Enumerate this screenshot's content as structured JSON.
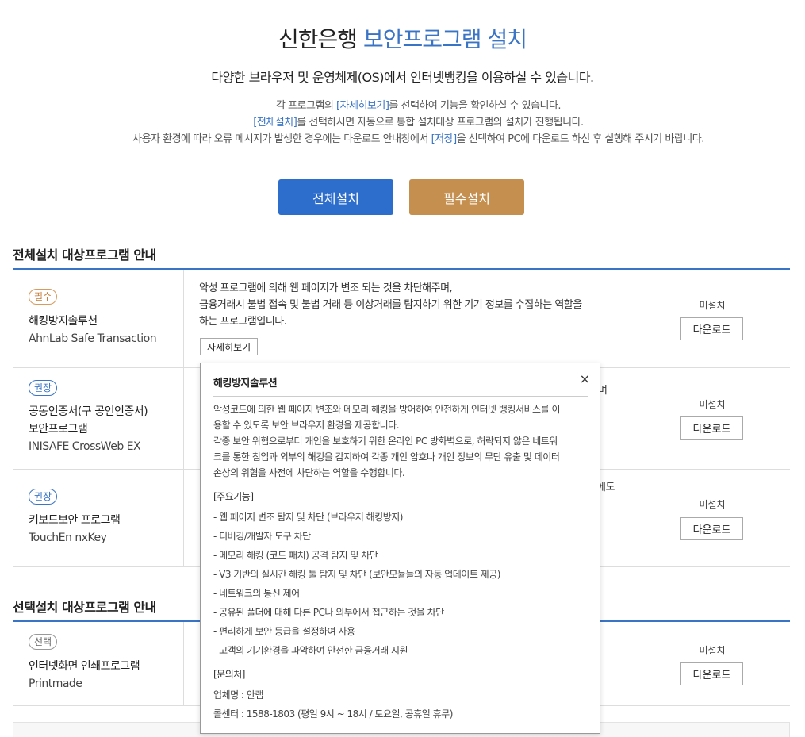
{
  "header": {
    "title_prefix": "신한은행",
    "title_accent": "보안프로그램 설치",
    "subtitle": "다양한 브라우저 및 운영체제(OS)에서 인터넷뱅킹을 이용하실 수 있습니다.",
    "desc_line1_a": "각 프로그램의 ",
    "desc_line1_hl": "[자세히보기]",
    "desc_line1_b": "를 선택하여 기능을 확인하실 수 있습니다.",
    "desc_line2_hl": "[전체설치]",
    "desc_line2_b": "를 선택하시면 자동으로 통합 설치대상 프로그램의 설치가 진행됩니다.",
    "desc_line3_a": "사용자 환경에 따라 오류 메시지가 발생한 경우에는 다운로드 안내창에서 ",
    "desc_line3_hl": "[저장]",
    "desc_line3_b": "을 선택하여 PC에 다운로드 하신 후 실행해 주시기 바랍니다."
  },
  "buttons": {
    "install_all": "전체설치",
    "install_required": "필수설치"
  },
  "sections": {
    "full_title": "전체설치 대상프로그램 안내",
    "optional_title": "선택설치 대상프로그램 안내"
  },
  "programs": [
    {
      "badge": "필수",
      "name_ko": "해킹방지솔루션",
      "name_en": "AhnLab Safe Transaction",
      "desc_1": "악성 프로그램에 의해 웹 페이지가 변조 되는 것을 차단해주며,",
      "desc_2": "금융거래시 불법 접속 및 불법 거래 등 이상거래를 탐지하기 위한 기기 정보를 수집하는 역할을",
      "desc_3": "하는 프로그램입니다.",
      "detail_label": "자세히보기",
      "status": "미설치",
      "download": "다운로드"
    },
    {
      "badge": "권장",
      "name_ko_1": "공동인증서(구 공인인증서)",
      "name_ko_2": "보안프로그램",
      "name_en": "INISAFE CrossWeb EX",
      "desc_frag": "며",
      "status": "미설치",
      "download": "다운로드"
    },
    {
      "badge": "권장",
      "name_ko": "키보드보안 프로그램",
      "name_en": "TouchEn nxKey",
      "desc_frag": "에도",
      "status": "미설치",
      "download": "다운로드"
    },
    {
      "badge": "선택",
      "name_ko": "인터넷화면 인쇄프로그램",
      "name_en": "Printmade",
      "status": "미설치",
      "download": "다운로드"
    }
  ],
  "popup": {
    "title": "해킹방지솔루션",
    "close": "×",
    "p1": "악성코드에 의한 웹 페이지 변조와 메모리 해킹을 방어하여 안전하게 인터넷 뱅킹서비스를 이",
    "p2": "용할 수 있도록 보안 브라우저 환경을 제공합니다.",
    "p3": "각종 보안 위협으로부터 개인을 보호하기 위한 온라인 PC 방화벽으로, 허락되지 않은 네트워",
    "p4": "크를 통한 침입과 외부의 해킹을 감지하여 각종 개인 암호나 개인 정보의 무단 유출 및 데이터",
    "p5": "손상의 위협을 사전에 차단하는 역할을 수행합니다.",
    "features_title": "[주요기능]",
    "features": [
      "-  웹 페이지 변조 탐지 및 차단 (브라우저 해킹방지)",
      "-  디버깅/개발자 도구 차단",
      "-  메모리 해킹 (코드 패치) 공격 탐지 및 차단",
      "-  V3 기반의 실시간 해킹 툴 탐지 및 차단 (보안모듈들의 자동 업데이트 제공)",
      "-  네트워크의 통신 제어",
      "-  공유된 폴더에 대해 다른 PC나 외부에서 접근하는 것을 차단",
      "-  편리하게 보안 등급을 설정하여 사용",
      "-  고객의 기기환경을 파악하여 안전한 금융거래 지원"
    ],
    "contact_title": "[문의처]",
    "company": "업체명 : 안랩",
    "callcenter": "콜센터 : 1588-1803 (평일 9시 ~ 18시 / 토요일, 공휴일 휴무)"
  }
}
